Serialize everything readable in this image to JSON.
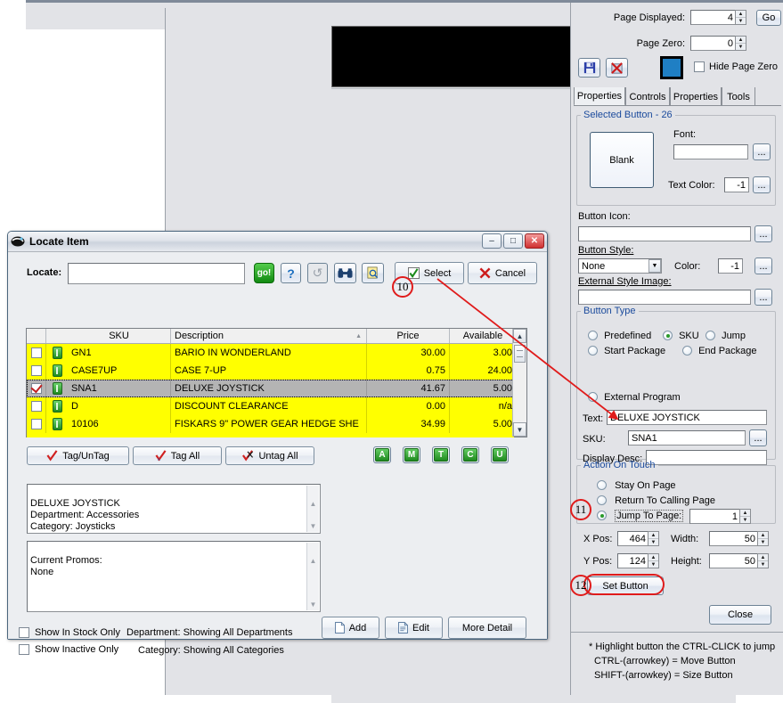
{
  "background": {
    "blank_button_label": "Blank"
  },
  "right_panel": {
    "page_displayed_label": "Page Displayed:",
    "page_displayed_value": "4",
    "go_button": "Go",
    "page_zero_label": "Page Zero:",
    "page_zero_value": "0",
    "hide_page_zero_label": "Hide Page Zero",
    "hide_page_zero_checked": false,
    "save_icon": "save-disk-icon",
    "delete_icon": "delete-x-icon",
    "color_swatch": "#1f7fc4",
    "tabs": [
      {
        "label": "Properties",
        "active": true
      },
      {
        "label": "Controls",
        "active": false
      },
      {
        "label": "Properties",
        "active": false
      },
      {
        "label": "Tools",
        "active": false
      }
    ],
    "selected_button": {
      "group_label": "Selected Button - 26",
      "preview_label": "Blank",
      "font_label": "Font:",
      "font_value": "",
      "font_browse": "...",
      "text_color_label": "Text Color:",
      "text_color_value": "-1",
      "text_color_browse": "..."
    },
    "button_icon_label": "Button Icon:",
    "button_icon_value": "",
    "button_icon_browse": "...",
    "button_style_label": "Button Style:",
    "button_style_value": "None",
    "color_label": "Color:",
    "color_value": "-1",
    "color_browse": "...",
    "external_style_image_label": "External Style Image:",
    "external_style_image_value": "",
    "external_style_browse": "...",
    "button_type": {
      "group_label": "Button Type",
      "options": [
        {
          "label": "Predefined",
          "selected": false
        },
        {
          "label": "SKU",
          "selected": true
        },
        {
          "label": "Jump",
          "selected": false
        },
        {
          "label": "Start Package",
          "selected": false
        },
        {
          "label": "End Package",
          "selected": false
        },
        {
          "label": "External Program",
          "selected": false
        }
      ],
      "text_label": "Text:",
      "text_value": "DELUXE JOYSTICK",
      "sku_label": "SKU:",
      "sku_value": "SNA1",
      "sku_browse": "...",
      "display_desc_label": "Display Desc:",
      "display_desc_value": ""
    },
    "action_on_touch": {
      "group_label": "Action On Touch",
      "options": [
        {
          "label": "Stay On Page",
          "selected": false
        },
        {
          "label": "Return To Calling Page",
          "selected": false
        },
        {
          "label": "Jump To Page:",
          "selected": true
        }
      ],
      "jump_page_value": "1"
    },
    "geometry": {
      "x_pos_label": "X Pos:",
      "x_pos_value": "464",
      "width_label": "Width:",
      "width_value": "50",
      "y_pos_label": "Y Pos:",
      "y_pos_value": "124",
      "height_label": "Height:",
      "height_value": "50"
    },
    "set_button_label": "Set Button",
    "close_button_label": "Close",
    "hints": [
      "* Highlight button the CTRL-CLICK to jump",
      "CTRL-(arrowkey) = Move Button",
      "SHIFT-(arrowkey) = Size Button"
    ]
  },
  "dialog": {
    "title": "Locate Item",
    "title_icon": "locate-item-icon",
    "minimize": "–",
    "maximize": "□",
    "close": "✕",
    "locate_label": "Locate:",
    "locate_value": "",
    "toolbar": [
      {
        "name": "go-button",
        "label": "go!"
      },
      {
        "name": "help-button",
        "label": "?"
      },
      {
        "name": "refresh-button",
        "label": "↺"
      },
      {
        "name": "find-button",
        "label": "binoculars-icon"
      },
      {
        "name": "preview-button",
        "label": "preview-icon"
      }
    ],
    "select_button": "Select",
    "cancel_button": "Cancel",
    "grid": {
      "columns": [
        "",
        "",
        "SKU",
        "Description",
        "Price",
        "Available"
      ],
      "sort_column": "Description",
      "rows": [
        {
          "checked": false,
          "sku": "GN1",
          "description": "BARIO IN WONDERLAND",
          "price": "30.00",
          "available": "3.00",
          "selected": false
        },
        {
          "checked": false,
          "sku": "CASE7UP",
          "description": "CASE 7-UP",
          "price": "0.75",
          "available": "24.00",
          "selected": false
        },
        {
          "checked": true,
          "sku": "SNA1",
          "description": "DELUXE JOYSTICK",
          "price": "41.67",
          "available": "5.00",
          "selected": true
        },
        {
          "checked": false,
          "sku": "D",
          "description": "DISCOUNT CLEARANCE",
          "price": "0.00",
          "available": "n/a",
          "selected": false
        },
        {
          "checked": false,
          "sku": "10106",
          "description": "FISKARS 9\" POWER GEAR HEDGE SHE",
          "price": "34.99",
          "available": "5.00",
          "selected": false
        }
      ]
    },
    "tag_buttons": [
      {
        "label": "Tag/UnTag",
        "icon": "check-mark-icon"
      },
      {
        "label": "Tag All",
        "icon": "check-mark-all-icon"
      },
      {
        "label": "Untag All",
        "icon": "untag-icon"
      }
    ],
    "letter_buttons": [
      "A",
      "M",
      "T",
      "C",
      "U"
    ],
    "detail_memo": "DELUXE JOYSTICK\nDepartment: Accessories\nCategory: Joysticks\nSuper joystick for your PC!",
    "promo_memo": "Current Promos:\n None",
    "show_in_stock_label": "Show In Stock Only",
    "show_in_stock_checked": false,
    "show_inactive_label": "Show Inactive Only",
    "show_inactive_checked": false,
    "department_label": "Department: Showing All Departments",
    "category_label": "Category: Showing All Categories",
    "add_button": "Add",
    "edit_button": "Edit",
    "more_detail_button": "More Detail"
  },
  "annotations": {
    "badges": [
      {
        "number": "10"
      },
      {
        "number": "11"
      },
      {
        "number": "12"
      }
    ],
    "accent_color": "#e01b1b"
  }
}
